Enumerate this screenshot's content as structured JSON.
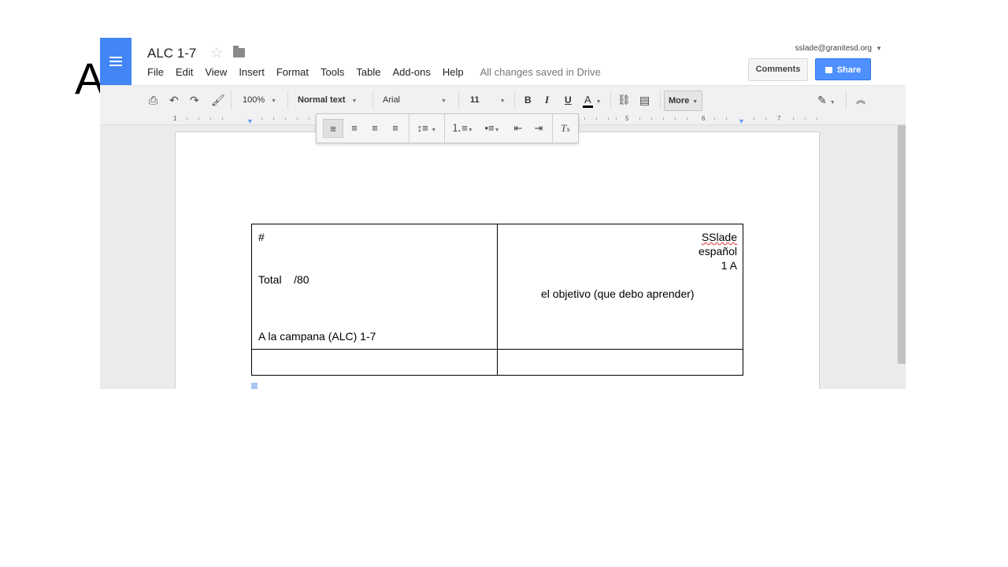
{
  "slide": {
    "letter": "A"
  },
  "header": {
    "doc_title": "ALC 1-7",
    "menu": [
      "File",
      "Edit",
      "View",
      "Insert",
      "Format",
      "Tools",
      "Table",
      "Add-ons",
      "Help"
    ],
    "save_status": "All changes saved in Drive",
    "account_email": "sslade@granitesd.org",
    "comments_label": "Comments",
    "share_label": "Share"
  },
  "toolbar": {
    "zoom": "100%",
    "style": "Normal text",
    "font": "Arial",
    "size": "11",
    "bold": "B",
    "italic": "I",
    "underline": "U",
    "text_color": "A",
    "more_label": "More"
  },
  "ruler": {
    "numbers": [
      "1",
      "5",
      "6",
      "7"
    ]
  },
  "document": {
    "cell1": {
      "hash": "#",
      "total": "Total    /80",
      "subtitle": "A la campana (ALC) 1-7"
    },
    "cell2": {
      "name": "SSlade",
      "subject": "español",
      "class": "1 A",
      "objective": "el objetivo (que debo aprender)"
    }
  },
  "colors": {
    "accent": "#4285f4",
    "share": "#4d90fe"
  }
}
